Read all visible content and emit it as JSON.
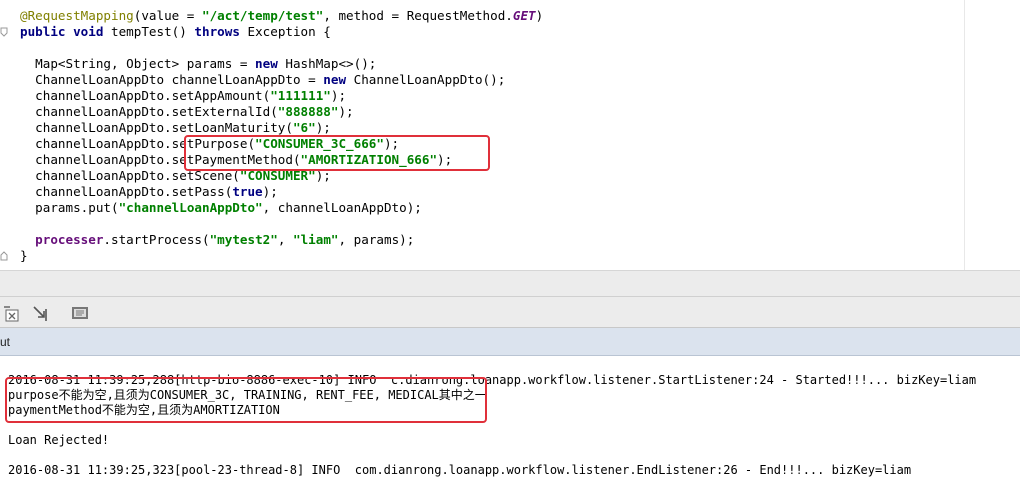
{
  "editor": {
    "lines": [
      {
        "parts": [
          {
            "t": "@RequestMapping",
            "c": "ann"
          },
          {
            "t": "(value = ",
            "c": ""
          },
          {
            "t": "\"/act/temp/test\"",
            "c": "str"
          },
          {
            "t": ", method = RequestMethod.",
            "c": ""
          },
          {
            "t": "GET",
            "c": "const"
          },
          {
            "t": ")",
            "c": ""
          }
        ]
      },
      {
        "parts": [
          {
            "t": "public void ",
            "c": "kw"
          },
          {
            "t": "tempTest() ",
            "c": ""
          },
          {
            "t": "throws ",
            "c": "kw"
          },
          {
            "t": "Exception {",
            "c": ""
          }
        ]
      },
      {
        "parts": []
      },
      {
        "parts": [
          {
            "t": "  Map<String, Object> params = ",
            "c": ""
          },
          {
            "t": "new ",
            "c": "kw"
          },
          {
            "t": "HashMap<>();",
            "c": ""
          }
        ]
      },
      {
        "parts": [
          {
            "t": "  ChannelLoanAppDto channelLoanAppDto = ",
            "c": ""
          },
          {
            "t": "new ",
            "c": "kw"
          },
          {
            "t": "ChannelLoanAppDto();",
            "c": ""
          }
        ]
      },
      {
        "parts": [
          {
            "t": "  channelLoanAppDto.setAppAmount(",
            "c": ""
          },
          {
            "t": "\"111111\"",
            "c": "str"
          },
          {
            "t": ");",
            "c": ""
          }
        ]
      },
      {
        "parts": [
          {
            "t": "  channelLoanAppDto.setExternalId(",
            "c": ""
          },
          {
            "t": "\"888888\"",
            "c": "str"
          },
          {
            "t": ");",
            "c": ""
          }
        ]
      },
      {
        "parts": [
          {
            "t": "  channelLoanAppDto.setLoanMaturity(",
            "c": ""
          },
          {
            "t": "\"6\"",
            "c": "str"
          },
          {
            "t": ");",
            "c": ""
          }
        ]
      },
      {
        "parts": [
          {
            "t": "  channelLoanAppDto.setPurpose(",
            "c": ""
          },
          {
            "t": "\"CONSUMER_3C_666\"",
            "c": "str"
          },
          {
            "t": ");",
            "c": ""
          }
        ]
      },
      {
        "parts": [
          {
            "t": "  channelLoanAppDto.setPaymentMethod(",
            "c": ""
          },
          {
            "t": "\"AMORTIZATION_666\"",
            "c": "str"
          },
          {
            "t": ");",
            "c": ""
          }
        ]
      },
      {
        "parts": [
          {
            "t": "  channelLoanAppDto.setScene(",
            "c": ""
          },
          {
            "t": "\"CONSUMER\"",
            "c": "str"
          },
          {
            "t": ");",
            "c": ""
          }
        ]
      },
      {
        "parts": [
          {
            "t": "  channelLoanAppDto.setPass(",
            "c": ""
          },
          {
            "t": "true",
            "c": "kw"
          },
          {
            "t": ");",
            "c": ""
          }
        ]
      },
      {
        "parts": [
          {
            "t": "  params.put(",
            "c": ""
          },
          {
            "t": "\"channelLoanAppDto\"",
            "c": "str"
          },
          {
            "t": ", channelLoanAppDto);",
            "c": ""
          }
        ]
      },
      {
        "parts": []
      },
      {
        "parts": [
          {
            "t": "  ",
            "c": ""
          },
          {
            "t": "processer",
            "c": "field"
          },
          {
            "t": ".startProcess(",
            "c": ""
          },
          {
            "t": "\"mytest2\"",
            "c": "str"
          },
          {
            "t": ", ",
            "c": ""
          },
          {
            "t": "\"liam\"",
            "c": "str"
          },
          {
            "t": ", params);",
            "c": ""
          }
        ]
      },
      {
        "parts": [
          {
            "t": "}",
            "c": ""
          }
        ]
      }
    ]
  },
  "run_panel": {
    "tab_label": "ut"
  },
  "console": {
    "lines": [
      "2016-08-31 11:39:25,288[http-bio-8886-exec-10] INFO  c.dianrong.loanapp.workflow.listener.StartListener:24 - Started!!!... bizKey=liam",
      "purpose不能为空,且须为CONSUMER_3C, TRAINING, RENT_FEE, MEDICAL其中之一",
      "paymentMethod不能为空,且须为AMORTIZATION",
      "",
      "Loan Rejected!",
      "",
      "2016-08-31 11:39:25,323[pool-23-thread-8] INFO  com.dianrong.loanapp.workflow.listener.EndListener:26 - End!!!... bizKey=liam"
    ]
  },
  "colors": {
    "highlight_box": "#e0303a",
    "tab_bar": "#dbe3ee",
    "keyword": "#000080",
    "string": "#008000"
  }
}
